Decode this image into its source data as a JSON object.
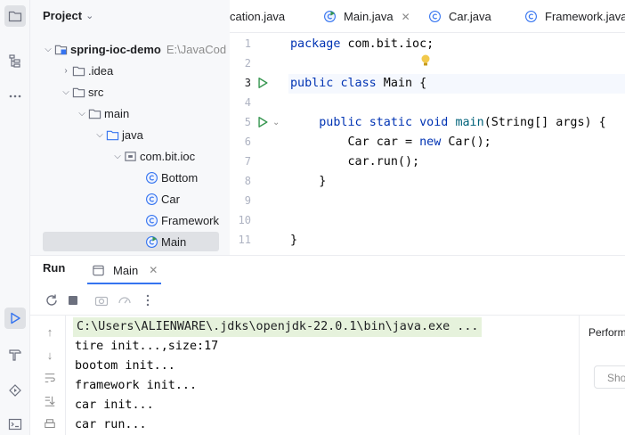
{
  "project": {
    "header": "Project",
    "tree": [
      {
        "label": "spring-ioc-demo",
        "path": "E:\\JavaCod",
        "kind": "module"
      },
      {
        "label": ".idea",
        "kind": "folder"
      },
      {
        "label": "src",
        "kind": "folder"
      },
      {
        "label": "main",
        "kind": "folder"
      },
      {
        "label": "java",
        "kind": "folder-src"
      },
      {
        "label": "com.bit.ioc",
        "kind": "package"
      },
      {
        "label": "Bottom",
        "kind": "class"
      },
      {
        "label": "Car",
        "kind": "class"
      },
      {
        "label": "Framework",
        "kind": "class"
      },
      {
        "label": "Main",
        "kind": "class-main"
      }
    ]
  },
  "editor": {
    "tabs": [
      {
        "label": "cation.java",
        "kind": "partial"
      },
      {
        "label": "Main.java",
        "kind": "main"
      },
      {
        "label": "Car.java",
        "kind": "class"
      },
      {
        "label": "Framework.java",
        "kind": "class"
      }
    ],
    "line_numbers": [
      "1",
      "2",
      "3",
      "4",
      "5",
      "6",
      "7",
      "8",
      "9",
      "10",
      "11"
    ],
    "lines": [
      {
        "segments": [
          {
            "t": "package",
            "c": "kw"
          },
          {
            "t": " com.bit.ioc;",
            "c": ""
          }
        ]
      },
      {
        "segments": []
      },
      {
        "segments": [
          {
            "t": "public",
            "c": "kw"
          },
          {
            "t": " ",
            "c": ""
          },
          {
            "t": "class",
            "c": "kw"
          },
          {
            "t": " Main {",
            "c": ""
          }
        ]
      },
      {
        "segments": []
      },
      {
        "segments": [
          {
            "t": "    ",
            "c": ""
          },
          {
            "t": "public",
            "c": "kw"
          },
          {
            "t": " ",
            "c": ""
          },
          {
            "t": "static",
            "c": "kw"
          },
          {
            "t": " ",
            "c": ""
          },
          {
            "t": "void",
            "c": "kw"
          },
          {
            "t": " ",
            "c": ""
          },
          {
            "t": "main",
            "c": "fn"
          },
          {
            "t": "(String[] args) {",
            "c": ""
          }
        ]
      },
      {
        "segments": [
          {
            "t": "        Car car = ",
            "c": ""
          },
          {
            "t": "new",
            "c": "kw"
          },
          {
            "t": " Car();",
            "c": ""
          }
        ]
      },
      {
        "segments": [
          {
            "t": "        car.run();",
            "c": ""
          }
        ]
      },
      {
        "segments": [
          {
            "t": "    }",
            "c": ""
          }
        ]
      },
      {
        "segments": []
      },
      {
        "segments": []
      },
      {
        "segments": [
          {
            "t": "}",
            "c": ""
          }
        ]
      }
    ]
  },
  "run": {
    "title": "Run",
    "tab_label": "Main",
    "console": [
      "C:\\Users\\ALIENWARE\\.jdks\\openjdk-22.0.1\\bin\\java.exe ...",
      "tire init...,size:17",
      "bootom init...",
      "framework init...",
      "car init...",
      "car run..."
    ],
    "side_panel_title": "Perform",
    "side_panel_button": "Sho"
  },
  "colors": {
    "accent": "#3574f0",
    "run_green": "#369650",
    "keyword": "#0033b3",
    "cmd_highlight": "#e6f2dc"
  }
}
